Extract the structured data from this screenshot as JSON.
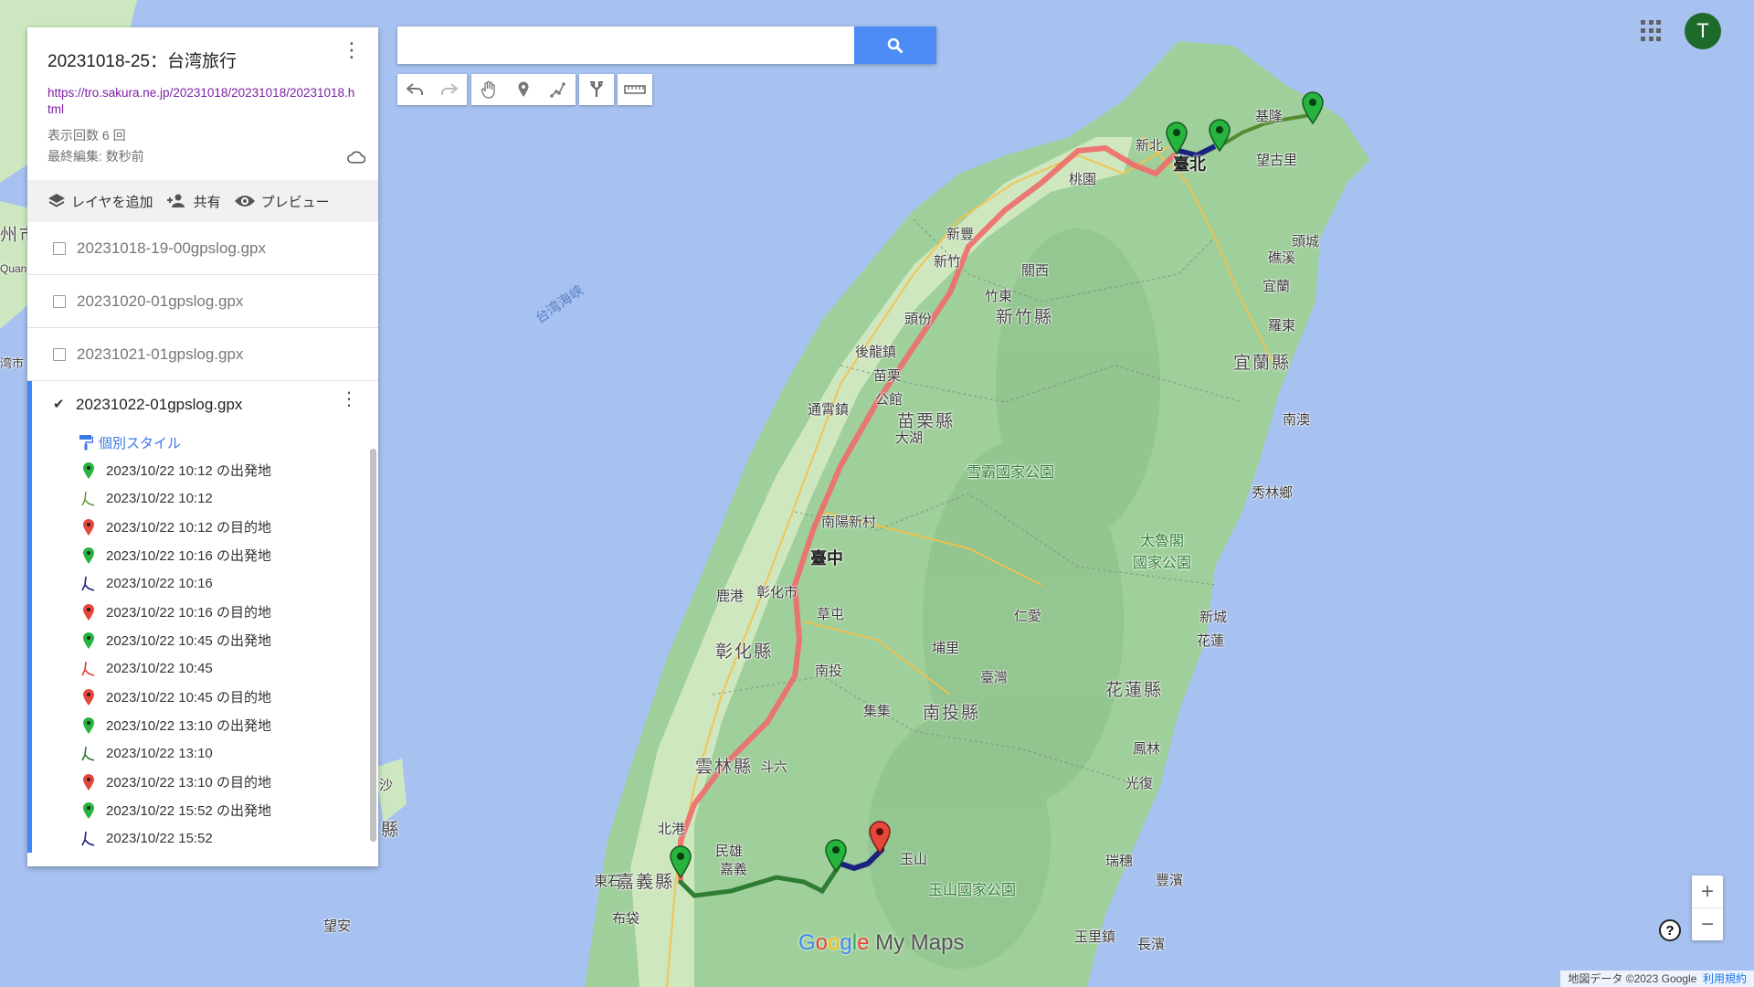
{
  "map": {
    "labels": {
      "taipei": "臺北",
      "xinbei": "新北",
      "taoyuan": "桃園",
      "keelung": "基隆",
      "wangguliao": "望古里",
      "toucheng": "頭城",
      "jiaoxi": "礁溪",
      "yilan": "宜蘭",
      "luodong": "羅東",
      "yilan_county": "宜蘭縣",
      "nanao": "南澳",
      "xinfeng": "新豐",
      "xinzhu": "新竹",
      "guanxi": "關西",
      "zhudong": "竹東",
      "hsinchu_county": "新竹縣",
      "toufen": "頭份",
      "houlong": "後龍鎮",
      "miaoli": "苗栗",
      "tongxiao": "通霄鎮",
      "gongguan": "公館",
      "miaoli_county": "苗栗縣",
      "dahu": "大湖",
      "shei_park": "雪霸國家公園",
      "xiulin": "秀林鄉",
      "taroko_park": "太魯閣\n國家公園",
      "nanyang": "南陽新村",
      "taichung": "臺中",
      "lugang": "鹿港",
      "changhua": "彰化市",
      "changhua_county": "彰化縣",
      "caotun": "草屯",
      "nantou": "南投",
      "puli": "埔里",
      "renai": "仁愛",
      "xincheng": "新城",
      "hualien": "花蓮",
      "taiwan_strait": "台湾海峡",
      "jiji": "集集",
      "nantou_county": "南投縣",
      "taiwan_station": "臺灣",
      "hualien_county": "花蓮縣",
      "yunlin_county": "雲林縣",
      "douliu": "斗六",
      "fenglin": "鳳林",
      "guangfu": "光復",
      "beigang": "北港",
      "minxiong": "民雄",
      "jiayi": "嘉義",
      "jiayi_county": "嘉義縣",
      "dongshi": "東石",
      "budai": "布袋",
      "yushan": "玉山",
      "yushan_park": "玉山國家公園",
      "ruisui": "瑞穗",
      "fengbin": "豐濱",
      "yuli": "玉里鎮",
      "changbin": "長濱",
      "wangan": "望安",
      "sha": "沙",
      "county": "縣",
      "city_left": "州市",
      "quan": "Quan",
      "wan": "湾市"
    }
  },
  "panel": {
    "title": "20231018-25：台湾旅行",
    "link": "https://tro.sakura.ne.jp/20231018/20231018/20231018.html",
    "view_count": "表示回数 6 回",
    "last_edit": "最終編集: 数秒前",
    "actions": {
      "add_layer": "レイヤを追加",
      "share": "共有",
      "preview": "プレビュー"
    },
    "layers_off": [
      "20231018-19-00gpslog.gpx",
      "20231020-01gpslog.gpx",
      "20231021-01gpslog.gpx"
    ],
    "active_layer": {
      "name": "20231022-01gpslog.gpx",
      "style": "個別スタイル",
      "items": [
        {
          "label": "2023/10/22 10:12 の出発地",
          "icon": "green-pin-icon",
          "color": "#26b33e"
        },
        {
          "label": "2023/10/22 10:12",
          "icon": "route-icon",
          "color": "#6a9a3e"
        },
        {
          "label": "2023/10/22 10:12 の目的地",
          "icon": "red-pin-icon",
          "color": "#e5473a"
        },
        {
          "label": "2023/10/22 10:16 の出発地",
          "icon": "green-pin-icon",
          "color": "#26b33e"
        },
        {
          "label": "2023/10/22 10:16",
          "icon": "route-icon",
          "color": "#1a237e"
        },
        {
          "label": "2023/10/22 10:16 の目的地",
          "icon": "red-pin-icon",
          "color": "#e5473a"
        },
        {
          "label": "2023/10/22 10:45 の出発地",
          "icon": "green-pin-icon",
          "color": "#26b33e"
        },
        {
          "label": "2023/10/22 10:45",
          "icon": "route-icon",
          "color": "#e53935"
        },
        {
          "label": "2023/10/22 10:45 の目的地",
          "icon": "red-pin-icon",
          "color": "#e5473a"
        },
        {
          "label": "2023/10/22 13:10 の出発地",
          "icon": "green-pin-icon",
          "color": "#26b33e"
        },
        {
          "label": "2023/10/22 13:10",
          "icon": "route-icon",
          "color": "#2e7d32"
        },
        {
          "label": "2023/10/22 13:10 の目的地",
          "icon": "red-pin-icon",
          "color": "#e5473a"
        },
        {
          "label": "2023/10/22 15:52 の出発地",
          "icon": "green-pin-icon",
          "color": "#26b33e"
        },
        {
          "label": "2023/10/22 15:52",
          "icon": "route-icon",
          "color": "#1a237e"
        }
      ]
    }
  },
  "search": {
    "placeholder": "",
    "value": ""
  },
  "account": {
    "initial": "T"
  },
  "zoom": {
    "in": "+",
    "out": "−"
  },
  "help": "?",
  "logo": {
    "g1": "G",
    "g2": "o",
    "g3": "o",
    "g4": "g",
    "g5": "l",
    "g6": "e",
    "rest": " My Maps"
  },
  "attribution": {
    "data": "地図データ ©2023 Google",
    "terms": "利用規約"
  },
  "colors": {
    "route_red": "#f06a6a",
    "route_green": "#2e7d32",
    "route_navy": "#1a237e",
    "accent": "#4285f4"
  }
}
